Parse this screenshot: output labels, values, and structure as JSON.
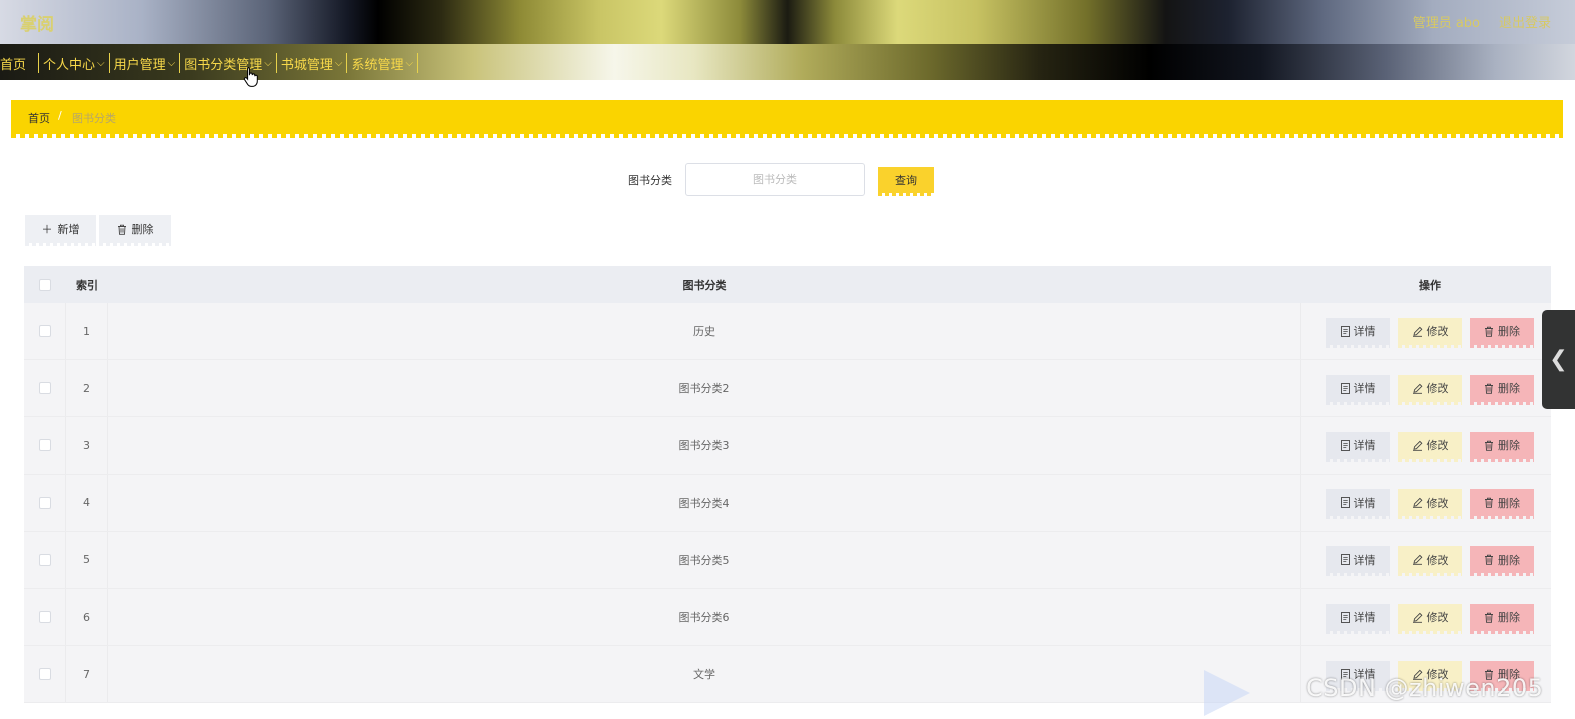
{
  "header": {
    "logo": "掌阅",
    "user": "管理员 abo",
    "logout": "退出登录"
  },
  "nav": {
    "items": [
      "首页",
      "个人中心",
      "用户管理",
      "图书分类管理",
      "书城管理",
      "系统管理"
    ]
  },
  "breadcrumb": {
    "home": "首页",
    "separator": "/",
    "current": "图书分类"
  },
  "search": {
    "label": "图书分类",
    "placeholder": "图书分类",
    "button": "查询"
  },
  "toolbar": {
    "add_label": "新增",
    "delete_label": "删除"
  },
  "table": {
    "columns": [
      "索引",
      "图书分类",
      "操作"
    ],
    "rows": [
      {
        "index": "1",
        "name": "历史"
      },
      {
        "index": "2",
        "name": "图书分类2"
      },
      {
        "index": "3",
        "name": "图书分类3"
      },
      {
        "index": "4",
        "name": "图书分类4"
      },
      {
        "index": "5",
        "name": "图书分类5"
      },
      {
        "index": "6",
        "name": "图书分类6"
      },
      {
        "index": "7",
        "name": "文学"
      }
    ],
    "actions": {
      "detail": "详情",
      "edit": "修改",
      "delete": "删除"
    }
  },
  "watermark": "CSDN @zhiwen205",
  "colors": {
    "accent_yellow": "#fad400",
    "nav_text": "#f7d84a",
    "delete_pink": "#f5b5b8",
    "edit_cream": "#f8f0c7"
  }
}
